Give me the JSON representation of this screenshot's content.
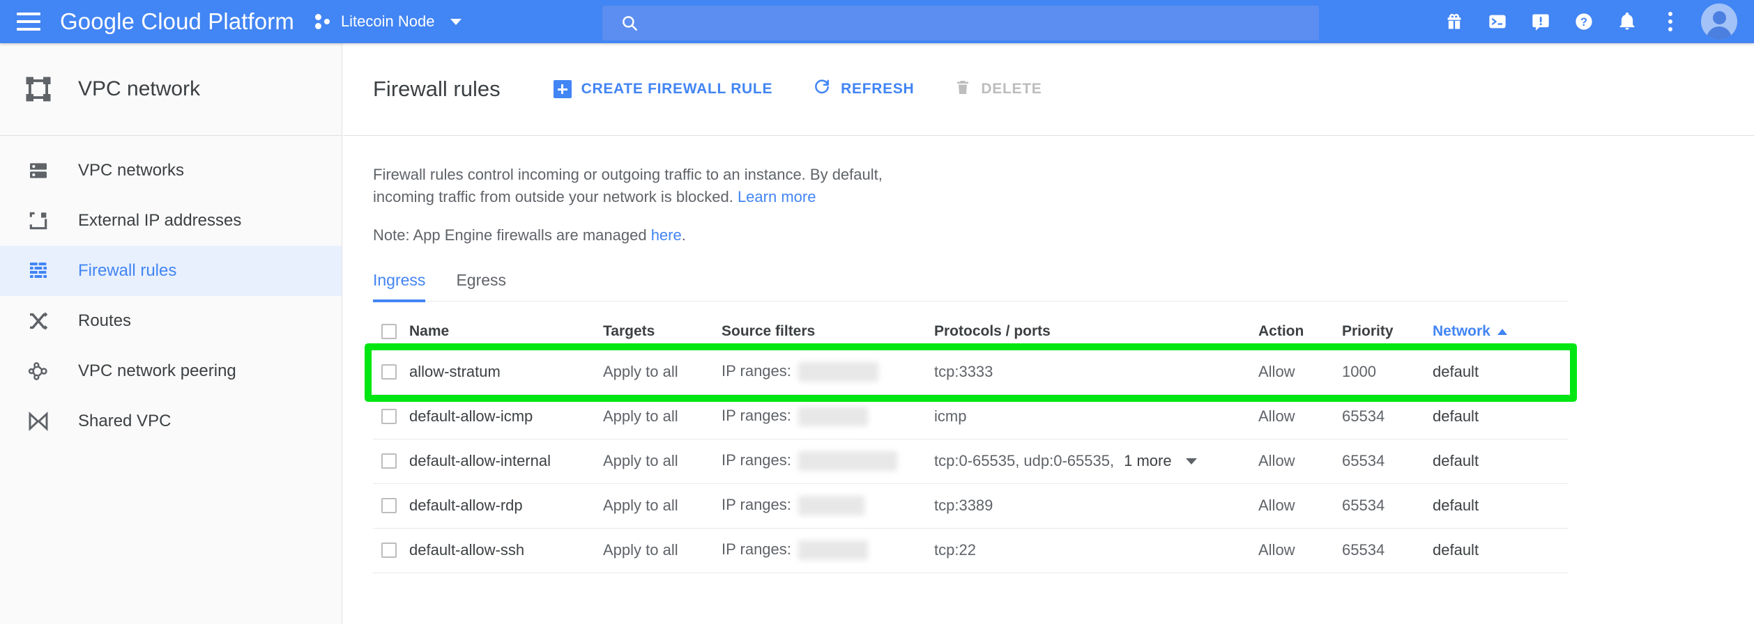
{
  "topbar": {
    "menu_icon": "hamburger-icon",
    "brand": "Google Cloud Platform",
    "project_name": "Litecoin Node",
    "project_icon": "project-dots-icon",
    "search": {
      "value": "",
      "placeholder": "",
      "icon": "search-icon"
    },
    "icons": [
      {
        "name": "gift-icon",
        "label": "Release notes"
      },
      {
        "name": "cloud-shell-icon",
        "label": "Activate Cloud Shell"
      },
      {
        "name": "feedback-icon",
        "label": "Send feedback"
      },
      {
        "name": "help-icon",
        "label": "Help"
      },
      {
        "name": "notifications-bell-icon",
        "label": "Notifications"
      },
      {
        "name": "more-options-icon",
        "label": "More options"
      },
      {
        "name": "avatar",
        "label": "Account"
      }
    ],
    "colors": {
      "bar": "#4285f4",
      "search_bg": "#5b8ef0"
    }
  },
  "sidebar": {
    "title": "VPC network",
    "title_icon": "vpc-network-icon",
    "items": [
      {
        "label": "VPC networks",
        "icon": "vpc-networks-icon",
        "active": false
      },
      {
        "label": "External IP addresses",
        "icon": "external-ip-icon",
        "active": false
      },
      {
        "label": "Firewall rules",
        "icon": "firewall-brick-icon",
        "active": true
      },
      {
        "label": "Routes",
        "icon": "routes-shuffle-icon",
        "active": false
      },
      {
        "label": "VPC network peering",
        "icon": "peering-nodes-icon",
        "active": false
      },
      {
        "label": "Shared VPC",
        "icon": "shared-vpc-bowtie-icon",
        "active": false
      }
    ]
  },
  "main": {
    "page_title": "Firewall rules",
    "toolbar": {
      "create_label": "CREATE FIREWALL RULE",
      "refresh_label": "REFRESH",
      "delete_label": "DELETE",
      "delete_disabled": true
    },
    "description": {
      "line1": "Firewall rules control incoming or outgoing traffic to an instance. By default,",
      "line2": "incoming traffic from outside your network is blocked. ",
      "learn_more": "Learn more",
      "note_prefix": "Note: App Engine firewalls are managed ",
      "note_link": "here",
      "note_suffix": "."
    },
    "tabs": [
      {
        "label": "Ingress",
        "active": true
      },
      {
        "label": "Egress",
        "active": false
      }
    ],
    "table": {
      "columns": [
        {
          "key": "name",
          "label": "Name",
          "sorted": false
        },
        {
          "key": "targets",
          "label": "Targets",
          "sorted": false
        },
        {
          "key": "source",
          "label": "Source filters",
          "sorted": false
        },
        {
          "key": "protocols",
          "label": "Protocols / ports",
          "sorted": false
        },
        {
          "key": "action",
          "label": "Action",
          "sorted": false
        },
        {
          "key": "priority",
          "label": "Priority",
          "sorted": false
        },
        {
          "key": "network",
          "label": "Network",
          "sorted": true,
          "sort_dir": "asc"
        }
      ],
      "rows": [
        {
          "name": "allow-stratum",
          "targets": "Apply to all",
          "source_label": "IP ranges:",
          "source_value_redacted": true,
          "protocols": "tcp:3333",
          "more": "",
          "action": "Allow",
          "priority": "1000",
          "network": "default",
          "checked": false,
          "highlighted": true
        },
        {
          "name": "default-allow-icmp",
          "targets": "Apply to all",
          "source_label": "IP ranges:",
          "source_value_redacted": true,
          "protocols": "icmp",
          "more": "",
          "action": "Allow",
          "priority": "65534",
          "network": "default",
          "checked": false,
          "highlighted": false
        },
        {
          "name": "default-allow-internal",
          "targets": "Apply to all",
          "source_label": "IP ranges:",
          "source_value_redacted": true,
          "protocols": "tcp:0-65535, udp:0-65535,",
          "more": "1 more",
          "action": "Allow",
          "priority": "65534",
          "network": "default",
          "checked": false,
          "highlighted": false
        },
        {
          "name": "default-allow-rdp",
          "targets": "Apply to all",
          "source_label": "IP ranges:",
          "source_value_redacted": true,
          "protocols": "tcp:3389",
          "more": "",
          "action": "Allow",
          "priority": "65534",
          "network": "default",
          "checked": false,
          "highlighted": false
        },
        {
          "name": "default-allow-ssh",
          "targets": "Apply to all",
          "source_label": "IP ranges:",
          "source_value_redacted": true,
          "protocols": "tcp:22",
          "more": "",
          "action": "Allow",
          "priority": "65534",
          "network": "default",
          "checked": false,
          "highlighted": false
        }
      ]
    },
    "highlight_color": "#00e612"
  }
}
